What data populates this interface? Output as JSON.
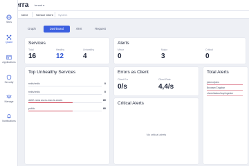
{
  "brand": {
    "name_prefix": "V",
    "name_rest": "olterra",
    "tenant": "tenant"
  },
  "sidebar": {
    "items": [
      {
        "label": "Sites",
        "icon": "globe-icon"
      },
      {
        "label": "Quant",
        "icon": "network-icon",
        "active": true
      },
      {
        "label": "Applications",
        "icon": "app-window-icon"
      },
      {
        "label": "Security",
        "icon": "shield-icon"
      },
      {
        "label": "Manage",
        "icon": "layers-icon"
      },
      {
        "label": "Notifications",
        "icon": "bell-icon"
      }
    ]
  },
  "breadcrumb": {
    "first": "Ident",
    "second": "Service Client",
    "third": "System"
  },
  "tabs": {
    "graph": "Graph",
    "dashboard": "Dashboard",
    "alert": "Alert",
    "request": "Request"
  },
  "services": {
    "title": "Services",
    "total_label": "Total",
    "total": "16",
    "healthy_label": "Healthy",
    "healthy": "12",
    "unhealthy_label": "Unhealthy",
    "unhealthy": "4"
  },
  "alerts": {
    "title": "Alerts",
    "minor_label": "Minor",
    "minor": "0",
    "major_label": "Major",
    "major": "3",
    "critical_label": "Critical",
    "critical": "0"
  },
  "unhealthy": {
    "title": "Top Unhealthy Services",
    "rows": [
      {
        "name": "redis/redis",
        "value": "0",
        "level": 0
      },
      {
        "name": "redis/redis",
        "value": "0",
        "level": 0
      },
      {
        "name": "dd02 zarra ascrs-max-ls-ances",
        "value": "80",
        "level": 0.6
      },
      {
        "name": "public",
        "value": "80",
        "level": 0.6
      }
    ]
  },
  "errors": {
    "title": "Errors as Client",
    "error_label": "Client Err",
    "error_value": "0/s",
    "traffic_label": "Client Rate",
    "traffic_value": "4,4/s"
  },
  "total_alerts": {
    "title": "Total Alerts",
    "rows": [
      "joinmo/joins",
      "Browser/Crigzbar",
      "check/status/hoy/ingester"
    ]
  },
  "critical_alerts": {
    "title": "Critical Alerts",
    "empty": "No critical alerts"
  },
  "colors": {
    "accent": "#3b5fe0",
    "danger": "#c53045",
    "success": "#1f8a4b"
  }
}
